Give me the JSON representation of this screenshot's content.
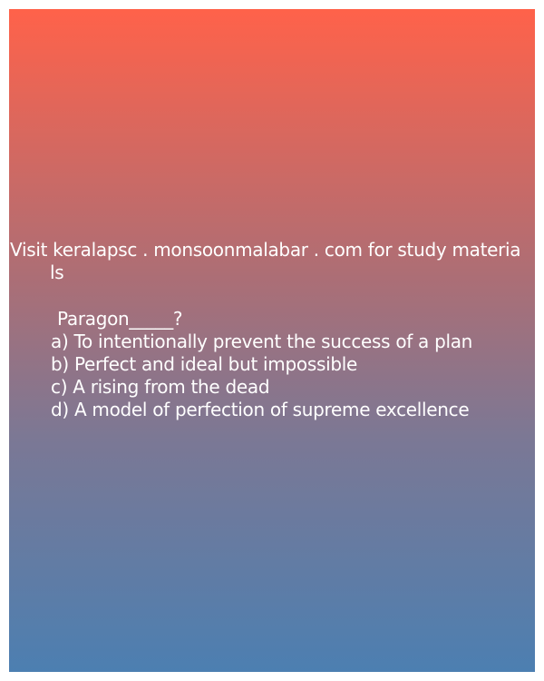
{
  "card": {
    "header_line1": "Visit keralapsc . monsoonmalabar . com for study materia",
    "header_line2": "ls",
    "question": "Paragon_____?",
    "options": [
      "a) To intentionally prevent the success of a plan",
      "b) Perfect and ideal but impossible",
      "c) A rising from the dead",
      "d) A model of perfection of supreme excellence"
    ]
  },
  "colors": {
    "gradient_top": "#ff624a",
    "gradient_bottom": "#4c7fb1",
    "text": "#ffffff"
  }
}
